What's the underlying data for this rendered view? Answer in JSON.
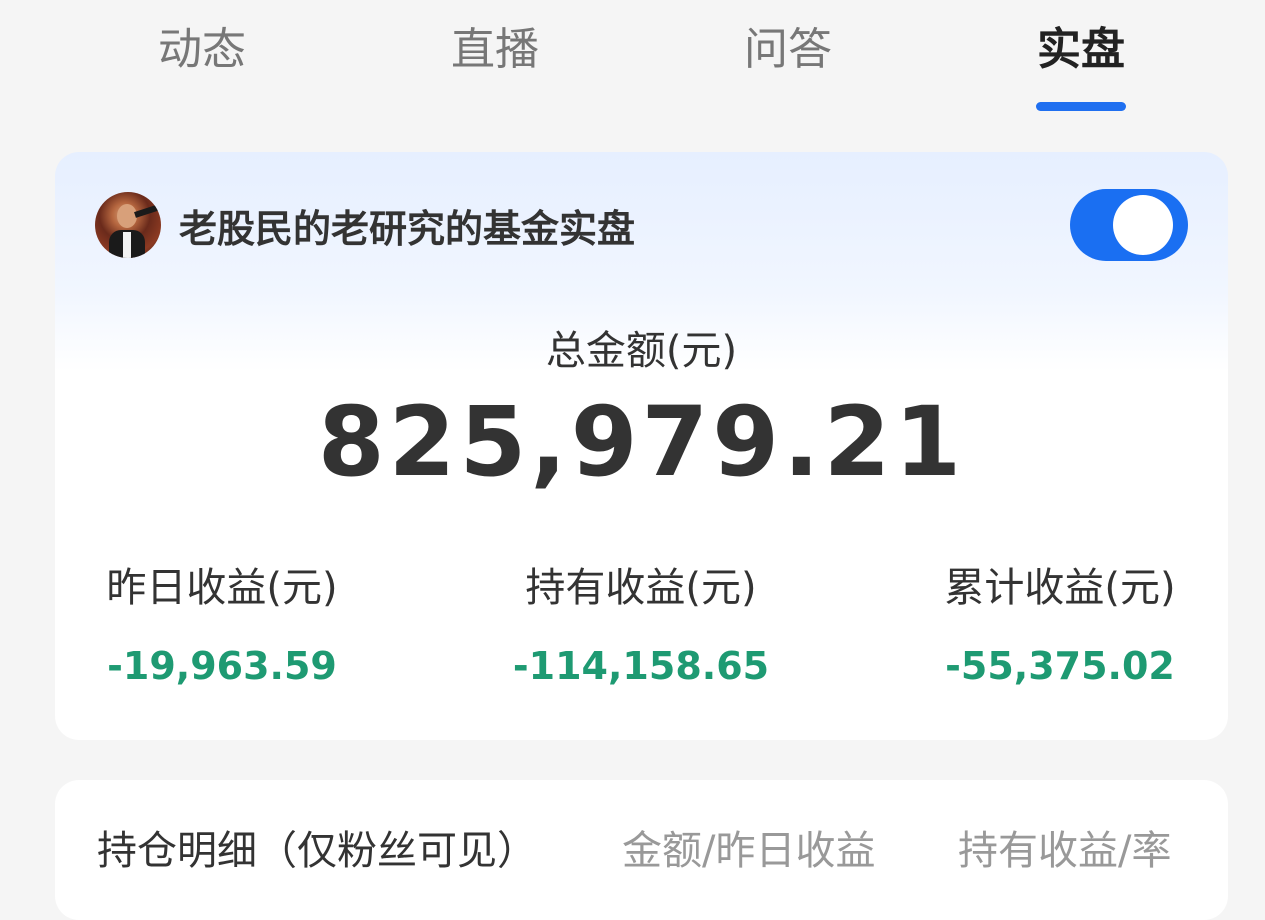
{
  "tabs": [
    {
      "label": "动态"
    },
    {
      "label": "直播"
    },
    {
      "label": "问答"
    },
    {
      "label": "实盘",
      "active": true
    }
  ],
  "portfolio": {
    "title": "老股民的老研究的基金实盘",
    "toggle_on": true,
    "total_label": "总金额(元)",
    "total_value": "825,979.21",
    "stats": [
      {
        "label": "昨日收益(元)",
        "value": "-19,963.59"
      },
      {
        "label": "持有收益(元)",
        "value": "-114,158.65"
      },
      {
        "label": "累计收益(元)",
        "value": "-55,375.02"
      }
    ]
  },
  "holdings": {
    "title": "持仓明细（仅粉丝可见）",
    "col_amount": "金额/昨日收益",
    "col_profit": "持有收益/率"
  },
  "colors": {
    "accent": "#1a6ff2",
    "loss_green": "#1e9a72"
  },
  "icons": {
    "avatar": "user-avatar"
  }
}
